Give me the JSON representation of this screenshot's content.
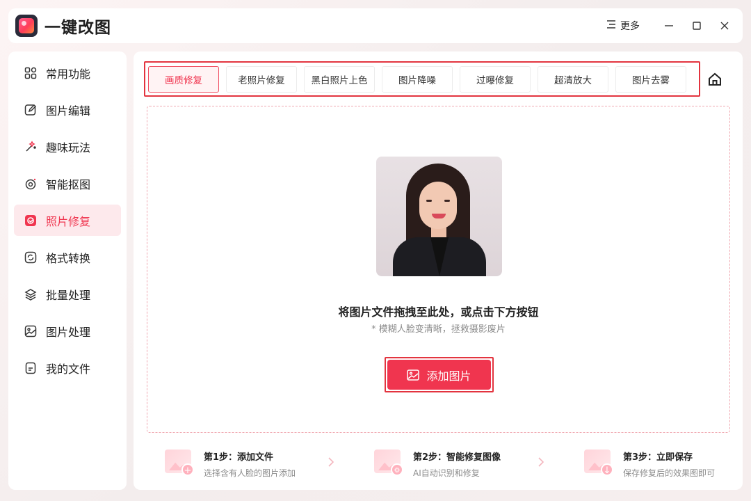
{
  "app": {
    "title": "一键改图",
    "more_label": "更多"
  },
  "sidebar": {
    "items": [
      {
        "label": "常用功能",
        "icon": "grid-icon"
      },
      {
        "label": "图片编辑",
        "icon": "edit-icon"
      },
      {
        "label": "趣味玩法",
        "icon": "magic-wand-icon"
      },
      {
        "label": "智能抠图",
        "icon": "cutout-icon"
      },
      {
        "label": "照片修复",
        "icon": "photo-repair-icon",
        "active": true
      },
      {
        "label": "格式转换",
        "icon": "convert-icon"
      },
      {
        "label": "批量处理",
        "icon": "layers-icon"
      },
      {
        "label": "图片处理",
        "icon": "image-icon"
      },
      {
        "label": "我的文件",
        "icon": "file-icon"
      }
    ]
  },
  "tabs": [
    {
      "label": "画质修复",
      "active": true
    },
    {
      "label": "老照片修复"
    },
    {
      "label": "黑白照片上色"
    },
    {
      "label": "图片降噪"
    },
    {
      "label": "过曝修复"
    },
    {
      "label": "超清放大"
    },
    {
      "label": "图片去雾"
    }
  ],
  "dropzone": {
    "title": "将图片文件拖拽至此处，或点击下方按钮",
    "subtitle": "* 模糊人脸变清晰，拯救摄影废片",
    "add_button_label": "添加图片"
  },
  "steps": [
    {
      "title": "第1步：添加文件",
      "desc": "选择含有人脸的图片添加",
      "badge": "+"
    },
    {
      "title": "第2步：智能修复图像",
      "desc": "AI自动识别和修复",
      "badge": "⚙"
    },
    {
      "title": "第3步：立即保存",
      "desc": "保存修复后的效果图即可",
      "badge": "↓"
    }
  ],
  "colors": {
    "accent": "#f0354f",
    "accent_light": "#fde9ec",
    "highlight_border": "#e3343f"
  }
}
